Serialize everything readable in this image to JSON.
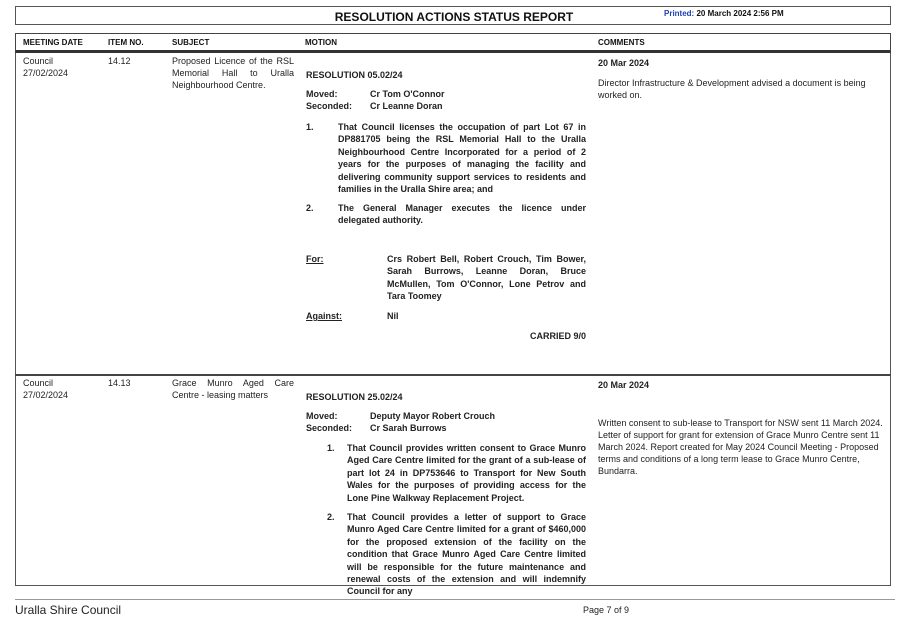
{
  "report": {
    "title": "RESOLUTION ACTIONS STATUS REPORT",
    "printed_label": "Printed:",
    "printed_value": "20 March 2024 2:56 PM"
  },
  "columns": [
    "MEETING DATE",
    "ITEM NO.",
    "SUBJECT",
    "MOTION",
    "COMMENTS"
  ],
  "rows": [
    {
      "meeting_line1": "Council",
      "meeting_line2": "27/02/2024",
      "item_no": "14.12",
      "subject": "Proposed Licence of the RSL Memorial Hall to Uralla Neighbourhood Centre.",
      "resolution": "RESOLUTION 05.02/24",
      "moved_label": "Moved:",
      "moved": "Cr Tom O'Connor",
      "seconded_label": "Seconded:",
      "seconded": "Cr Leanne Doran",
      "points": [
        {
          "num": "1.",
          "text": "That Council licenses the occupation of part Lot 67 in DP881705 being the RSL Memorial Hall to the Uralla Neighbourhood Centre Incorporated for a period of 2 years for the purposes of managing the facility and delivering community support services to residents and families in the Uralla Shire area; and"
        },
        {
          "num": "2.",
          "text": "The General Manager executes the licence under delegated authority."
        }
      ],
      "for_label": "For:",
      "for_text": "Crs Robert Bell, Robert Crouch, Tim Bower, Sarah Burrows, Leanne Doran, Bruce McMullen, Tom O'Connor, Lone Petrov and Tara Toomey",
      "against_label": "Against:",
      "against_text": "Nil",
      "carried": "CARRIED 9/0",
      "comment_date": "20 Mar 2024",
      "comment": "Director Infrastructure & Development advised a document is being worked on."
    },
    {
      "meeting_line1": "Council",
      "meeting_line2": "27/02/2024",
      "item_no": "14.13",
      "subject": "Grace Munro Aged Care Centre - leasing matters",
      "resolution": "RESOLUTION 25.02/24",
      "moved_label": "Moved:",
      "moved": "Deputy Mayor Robert Crouch",
      "seconded_label": "Seconded:",
      "seconded": "Cr Sarah Burrows",
      "points": [
        {
          "num": "1.",
          "text": "That Council provides written consent to Grace Munro Aged Care Centre limited for the grant of a sub-lease of part lot 24 in DP753646 to Transport for New South Wales for the purposes of providing access for the Lone Pine Walkway Replacement Project."
        },
        {
          "num": "2.",
          "text": "That Council provides a letter of support to Grace Munro Aged Care Centre limited for a grant of $460,000 for the proposed extension of the facility on the condition that Grace Munro Aged Care Centre limited will be responsible for the future maintenance and renewal costs of the extension and will indemnify Council for any"
        }
      ],
      "comment_date": "20 Mar 2024",
      "comment": "Written consent to sub-lease to Transport for NSW sent 11 March 2024. Letter of support for grant for extension of Grace Munro Centre sent 11 March 2024. Report created for May 2024 Council Meeting - Proposed terms and conditions of a long term lease to Grace Munro Centre, Bundarra."
    }
  ],
  "footer": {
    "organisation": "Uralla Shire Council",
    "page": "Page 7 of 9"
  }
}
